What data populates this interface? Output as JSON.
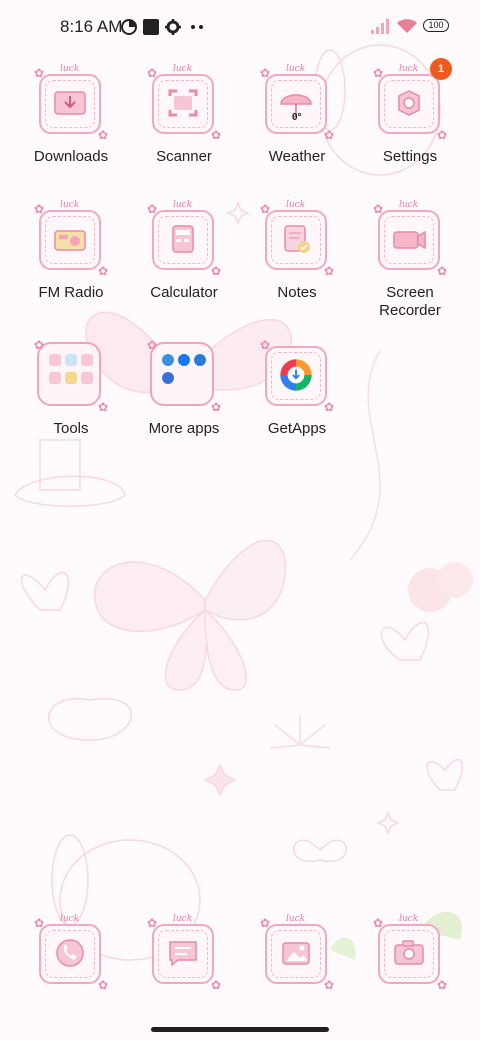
{
  "status_bar": {
    "time": "8:16 AM",
    "icons": [
      "data-saver-icon",
      "square-icon",
      "gear-icon",
      "more-dots-icon",
      "signal-icon",
      "wifi-icon",
      "battery-icon"
    ],
    "battery": "100"
  },
  "theme": {
    "accent": "#f1a9bf",
    "badge": "#ef5a1f",
    "tile_bg": "#fff7fa"
  },
  "apps": {
    "downloads": {
      "label": "Downloads",
      "icon": "download-folder-icon"
    },
    "scanner": {
      "label": "Scanner",
      "icon": "scanner-icon"
    },
    "weather": {
      "label": "Weather",
      "icon": "umbrella-icon",
      "temp": "0°"
    },
    "settings": {
      "label": "Settings",
      "icon": "gear-icon",
      "badge": "1"
    },
    "fm_radio": {
      "label": "FM Radio",
      "icon": "radio-icon"
    },
    "calculator": {
      "label": "Calculator",
      "icon": "calculator-icon"
    },
    "notes": {
      "label": "Notes",
      "icon": "notes-icon"
    },
    "screen_recorder": {
      "label": "Screen\nRecorder",
      "icon": "video-camera-icon"
    },
    "tools": {
      "label": "Tools",
      "icon": "folder-icon"
    },
    "more_apps": {
      "label": "More apps",
      "icon": "folder-icon"
    },
    "getapps": {
      "label": "GetApps",
      "icon": "getapps-icon"
    }
  },
  "dock": {
    "phone": {
      "icon": "phone-icon"
    },
    "messages": {
      "icon": "message-icon"
    },
    "gallery": {
      "icon": "gallery-icon"
    },
    "camera": {
      "icon": "camera-icon"
    }
  },
  "decor": {
    "luck_text": "luck"
  }
}
